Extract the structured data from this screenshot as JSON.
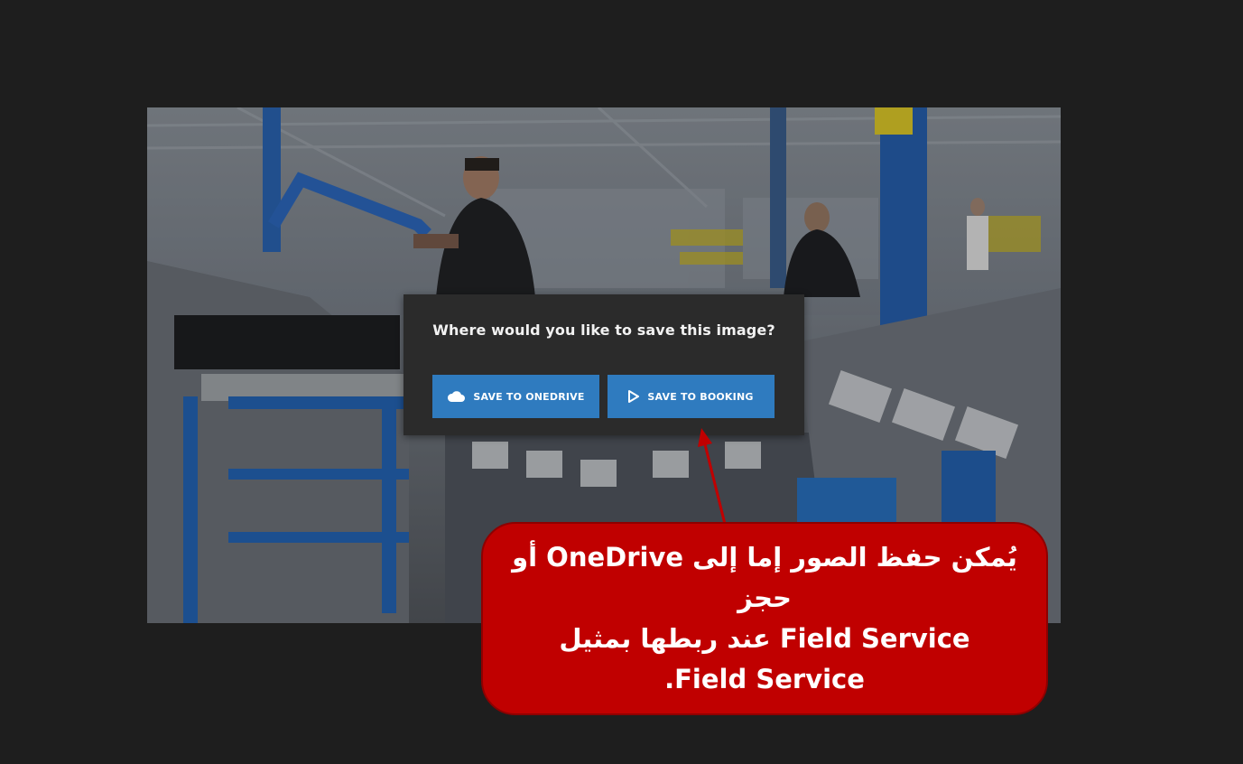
{
  "dialog": {
    "question": "Where would you like to save this image?",
    "buttons": [
      {
        "label": "SAVE TO ONEDRIVE",
        "icon": "cloud-icon"
      },
      {
        "label": "SAVE TO BOOKING",
        "icon": "play-icon"
      }
    ]
  },
  "callout": {
    "lines": [
      "يُمكن حفظ الصور إما إلى OneDrive أو حجز",
      "Field Service عند ربطها بمثيل",
      "Field Service."
    ],
    "color": "#c00000"
  },
  "colors": {
    "background": "#1e1e1e",
    "dialog": "#2b2b2b",
    "button": "#2f7bbf",
    "arrow": "#c00000"
  }
}
